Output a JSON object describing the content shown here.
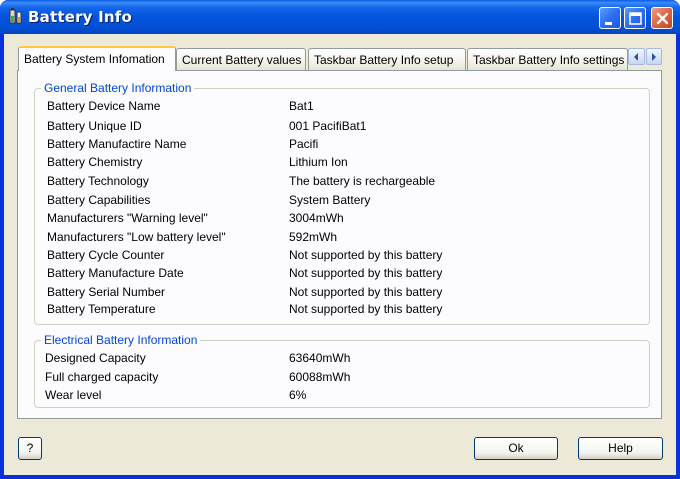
{
  "window": {
    "title": "Battery Info"
  },
  "tabs": [
    {
      "label": "Battery System Infomation",
      "active": true
    },
    {
      "label": "Current Battery values",
      "active": false
    },
    {
      "label": "Taskbar Battery Info setup",
      "active": false
    },
    {
      "label": "Taskbar Battery Info settings",
      "active": false
    }
  ],
  "general": {
    "title": "General Battery Information",
    "rows": [
      {
        "label": "Battery Device Name",
        "value": "Bat1"
      },
      {
        "label": "Battery Unique ID",
        "value": "001 PacifiBat1"
      },
      {
        "label": "Battery Manufactire Name",
        "value": "Pacifi"
      },
      {
        "label": "Battery Chemistry",
        "value": "Lithium Ion"
      },
      {
        "label": "Battery Technology",
        "value": "The battery is rechargeable"
      },
      {
        "label": "Battery Capabilities",
        "value": "System Battery"
      },
      {
        "label": "Manufacturers \"Warning level\"",
        "value": "3004mWh"
      },
      {
        "label": "Manufacturers \"Low battery level\"",
        "value": "592mWh"
      },
      {
        "label": "Battery Cycle Counter",
        "value": "Not supported by this battery"
      },
      {
        "label": "Battery Manufacture Date",
        "value": "Not supported by this battery"
      },
      {
        "label": "Battery Serial Number",
        "value": "Not supported by this battery"
      },
      {
        "label": "Battery Temperature",
        "value": "Not supported by this battery"
      }
    ]
  },
  "electrical": {
    "title": "Electrical Battery Information",
    "rows": [
      {
        "label": "Designed Capacity",
        "value": "63640mWh"
      },
      {
        "label": "Full charged capacity",
        "value": "60088mWh"
      },
      {
        "label": "Wear level",
        "value": "6%"
      }
    ]
  },
  "buttons": {
    "help_q": "?",
    "ok": "Ok",
    "help": "Help"
  },
  "colors": {
    "title_bar": "#0354dc",
    "group_title": "#0046d5",
    "tab_highlight": "#ffc83c",
    "dialog_bg": "#ece9d8"
  },
  "icons": {
    "app": "battery-icon",
    "minimize": "minimize-icon",
    "maximize": "maximize-icon",
    "close": "close-icon",
    "tab_left": "arrow-left-icon",
    "tab_right": "arrow-right-icon"
  }
}
